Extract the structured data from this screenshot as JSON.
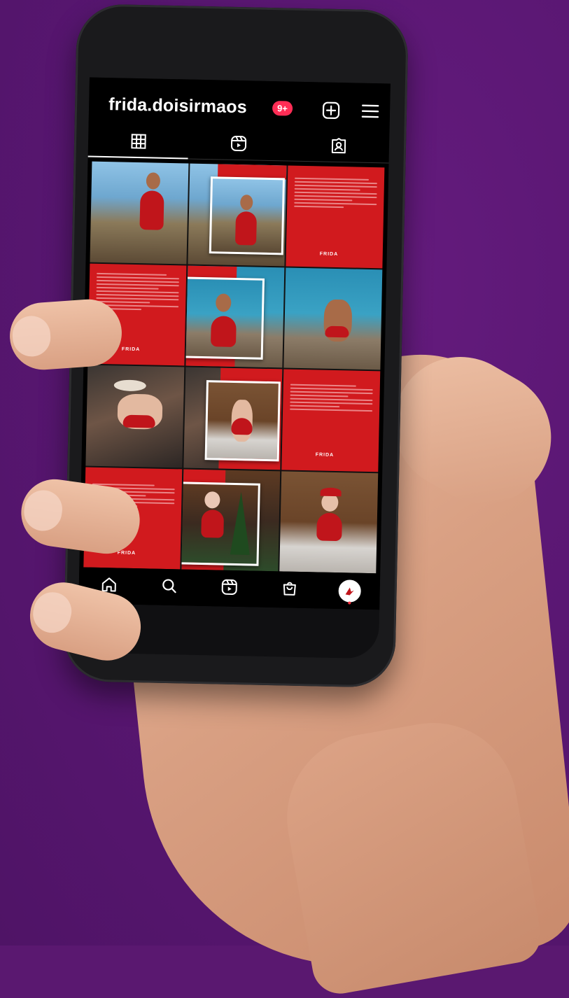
{
  "profile": {
    "username": "frida.doisirmaos",
    "notification_badge": "9+"
  },
  "header_icons": [
    "plus-square-icon",
    "menu-icon"
  ],
  "tabs": [
    {
      "name": "posts-grid",
      "icon": "grid-icon",
      "active": true
    },
    {
      "name": "reels",
      "icon": "reels-icon",
      "active": false
    },
    {
      "name": "tagged",
      "icon": "tagged-icon",
      "active": false
    }
  ],
  "bottom_nav": [
    {
      "name": "home",
      "icon": "home-icon",
      "active": true
    },
    {
      "name": "search",
      "icon": "search-icon",
      "active": false
    },
    {
      "name": "reels",
      "icon": "reels-icon",
      "active": false
    },
    {
      "name": "shop",
      "icon": "shop-icon",
      "active": false
    },
    {
      "name": "profile",
      "icon": "avatar",
      "active": false
    }
  ],
  "colors": {
    "background": "#5a1870",
    "post_red": "#d11a1e",
    "badge": "#ff2d55"
  }
}
